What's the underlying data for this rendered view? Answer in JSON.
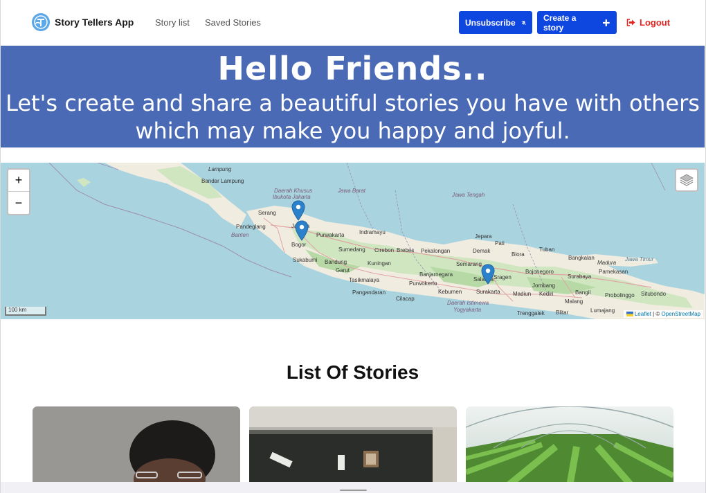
{
  "header": {
    "brand_name": "Story Tellers App",
    "nav_links": [
      "Story list",
      "Saved Stories"
    ],
    "unsubscribe_label": "Unsubscribe",
    "create_label": "Create a story",
    "logout_label": "Logout",
    "accent_color": "#0d47e0",
    "logout_color": "#e8231f",
    "icons": [
      "bell-slash-icon",
      "plus-icon",
      "logout-icon"
    ]
  },
  "hero": {
    "title": "Hello Friends..",
    "subtitle_line1": "Let's create and share a beautiful stories you have with others",
    "subtitle_line2": "which may make you happy and joyful.",
    "background_color": "#4a6ab5"
  },
  "map": {
    "zoom_in": "+",
    "zoom_out": "−",
    "scale_label": "100 km",
    "attribution_leaflet": "Leaflet",
    "attribution_sep": " | © ",
    "attribution_osm": "OpenStreetMap",
    "labels": {
      "lampung": "Lampung",
      "bandar_lampung": "Bandar Lampung",
      "dki1": "Daerah Khusus",
      "dki2": "Ibukota Jakarta",
      "jawa_barat": "Jawa Barat",
      "jawa_tengah": "Jawa Tengah",
      "serang": "Serang",
      "pandeglang": "Pandeglang",
      "banten": "Banten",
      "jakarta": "Jakarta",
      "purwakarta": "Purwakarta",
      "indramayu": "Indramayu",
      "bogor": "Bogor",
      "sumedang": "Sumedang",
      "cirebon": "Cirebon",
      "brebes": "Brebes",
      "pekalongan": "Pekalongan",
      "jepara": "Jepara",
      "pati": "Pati",
      "tuban": "Tuban",
      "demak": "Demak",
      "blora": "Blora",
      "bangkalan": "Bangkalan",
      "madura": "Madura",
      "jawa_timur": "Jawa Timur",
      "sukabumi": "Sukabumi",
      "bandung": "Bandung",
      "kuningan": "Kuningan",
      "semarang": "Semarang",
      "garut": "Garut",
      "banjarnegara": "Banjarnegara",
      "salatiga": "Salatiga",
      "bojonegoro": "Bojonegoro",
      "pamekasan": "Pamekasan",
      "tasikmalaya": "Tasikmalaya",
      "purwokerto": "Purwokerto",
      "surabaya": "Surabaya",
      "jombang": "Jombang",
      "pangandaran": "Pangandaran",
      "kebumen": "Kebumen",
      "surakarta": "Surakarta",
      "madiun": "Madiun",
      "kediri": "Kediri",
      "bangil": "Bangil",
      "probolinggo": "Probolinggo",
      "situbondo": "Situbondo",
      "cilacap": "Cilacap",
      "diy1": "Daerah Istimewa",
      "diy2": "Yogyakarta",
      "malang": "Malang",
      "trenggalek": "Trenggalek",
      "blitar": "Blitar",
      "lumajang": "Lumajang",
      "sragen": "Sragen"
    }
  },
  "stories": {
    "title": "List Of Stories"
  }
}
